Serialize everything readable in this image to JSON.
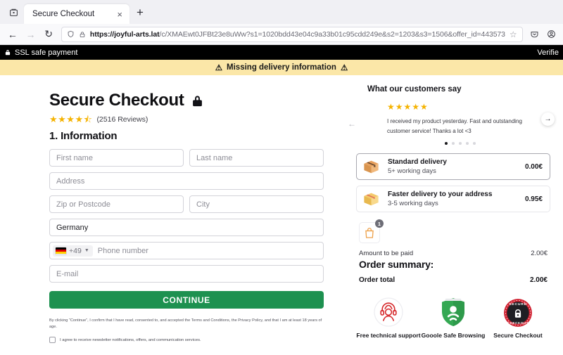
{
  "browser": {
    "tab_title": "Secure Checkout",
    "tab_close": "×",
    "new_tab": "+",
    "back": "←",
    "forward": "→",
    "reload": "↻",
    "url_host": "https://joyful-arts.lat",
    "url_path": "/c/XMAEwt0JFBt23e8uWw?s1=1020bdd43e04c9a33b01c95cdd249e&s2=1203&s3=1506&offer_id=443573",
    "bookmark_icon": "☆"
  },
  "ssl_bar": {
    "text": "SSL safe payment",
    "lock_icon": "🔒",
    "right_text": "Verifie"
  },
  "warning": {
    "text": "Missing delivery information",
    "icon": "⚠"
  },
  "checkout": {
    "title": "Secure Checkout",
    "stars": "★★★★",
    "half_star": "⯪",
    "reviews": "(2516 Reviews)",
    "step_title": "1. Information",
    "fields": {
      "first_name": "First name",
      "last_name": "Last name",
      "address": "Address",
      "zip": "Zip or Postcode",
      "city": "City",
      "country": "Germany",
      "country_code": "+49",
      "phone": "Phone number",
      "email": "E-mail"
    },
    "continue_label": "CONTINUE",
    "legal_text": "By clicking “Continue”, I confirm that I have read, consented to, and accepted the Terms and Conditions, the Privacy Policy, and that I am at least 18 years of age.",
    "newsletter_text": "I agree to receive newsletter notifications, offers, and communication services."
  },
  "testimonial": {
    "heading": "What our customers say",
    "stars": "★★★★★",
    "text": "I received my product yesterday. Fast and outstanding customer service! Thanks a lot <3",
    "prev_icon": "←",
    "next_icon": "→",
    "dots_count": 5,
    "active_dot": 0
  },
  "shipping": {
    "options": [
      {
        "name": "Standard delivery",
        "eta": "5+ working days",
        "price": "0.00€",
        "selected": true
      },
      {
        "name": "Faster delivery to your address",
        "eta": "3-5 working days",
        "price": "0.95€",
        "selected": false
      }
    ]
  },
  "summary": {
    "cart_count": "1",
    "amount_label": "Amount to be paid",
    "amount_value": "2.00€",
    "title": "Order summary:",
    "total_label": "Order total",
    "total_value": "2.00€"
  },
  "trust_badges": [
    {
      "label": "Free technical support"
    },
    {
      "label": "Gooole Safe Browsing"
    },
    {
      "label": "Secure Checkout"
    }
  ],
  "colors": {
    "accent_green": "#1d9150",
    "warning_bg": "#fbe7a8",
    "star_gold": "#f5b301",
    "ssl_bar_bg": "#000000"
  }
}
